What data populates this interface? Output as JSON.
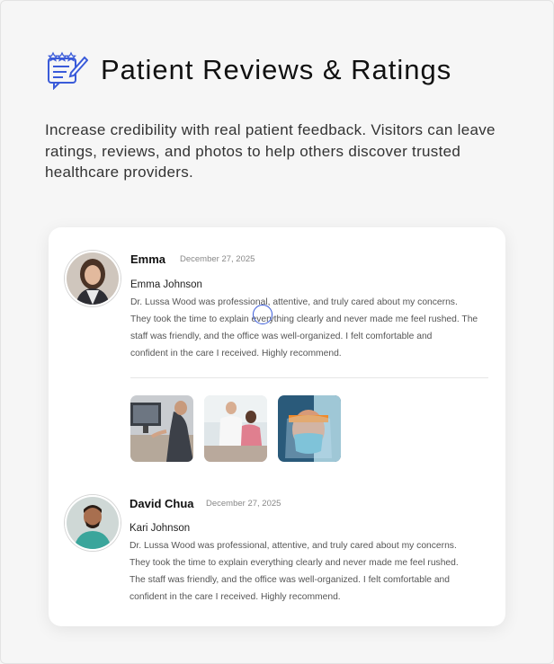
{
  "header": {
    "icon": "review-stars-icon",
    "title": "Patient Reviews & Ratings"
  },
  "intro": "Increase credibility with real patient feedback. Visitors can leave ratings, reviews, and photos to help others discover trusted healthcare providers.",
  "reviews": [
    {
      "name": "Emma",
      "date": "December 27, 2025",
      "reviewer": "Emma Johnson",
      "lines": [
        "Dr. Lussa Wood was professional, attentive, and truly cared about my concerns.",
        "They took the time to explain everything clearly and never made me feel rushed. The",
        "staff was friendly, and the office was well-organized. I felt comfortable and",
        "confident in the care I received. Highly recommend."
      ],
      "photos": [
        "computer-desk-photo",
        "doctor-patient-photo",
        "face-shield-photo"
      ]
    },
    {
      "name": "David Chua",
      "date": "December 27, 2025",
      "reviewer": "Kari Johnson",
      "lines": [
        "Dr. Lussa Wood was professional, attentive, and truly cared about my concerns.",
        "They took the time to explain everything clearly and never made me feel rushed.",
        "The staff was friendly, and the office was well-organized. I felt comfortable and",
        "confident in the care I received. Highly recommend."
      ]
    }
  ],
  "colors": {
    "accent": "#3a5bd9",
    "card": "#ffffff",
    "background": "#f6f6f6"
  }
}
